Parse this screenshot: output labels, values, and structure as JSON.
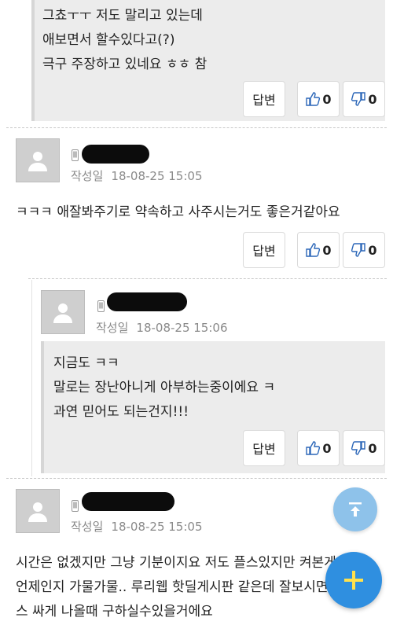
{
  "comments": [
    {
      "lines": [
        "그쵸ㅜㅜ 저도 말리고 있는데",
        "애보면서 할수있다고(?)",
        "극구 주장하고 있네요 ㅎㅎ 참"
      ],
      "reply_label": "답변",
      "likes": "0",
      "dislikes": "0"
    },
    {
      "author_label": "작성일",
      "date": "18-08-25 15:05",
      "lines": [
        "ㅋㅋㅋ 애잘봐주기로 약속하고 사주시는거도 좋은거같아요"
      ],
      "reply_label": "답변",
      "likes": "0",
      "dislikes": "0"
    },
    {
      "author_label": "작성일",
      "date": "18-08-25 15:06",
      "lines": [
        "지금도 ㅋㅋ",
        "말로는 장난아니게 아부하는중이에요 ㅋ",
        "과연 믿어도 되는건지!!!"
      ],
      "reply_label": "답변",
      "likes": "0",
      "dislikes": "0"
    },
    {
      "author_label": "작성일",
      "date": "18-08-25 15:05",
      "lines": [
        "시간은 없겠지만 그냥 기분이지요 저도 플스있지만 켜본게",
        "언제인지 가물가물.. 루리웹 핫딜게시판 같은데 잘보시면 플",
        "스 싸게 나올때 구하실수있을거에요"
      ]
    }
  ],
  "fab": {
    "top_icon": "scroll-top-icon",
    "add_icon": "plus-icon"
  },
  "colors": {
    "fab_top": "#8ec2ea",
    "fab_add": "#2f8fe0",
    "quote_bg": "#ececec",
    "plus": "#ffe14d"
  }
}
